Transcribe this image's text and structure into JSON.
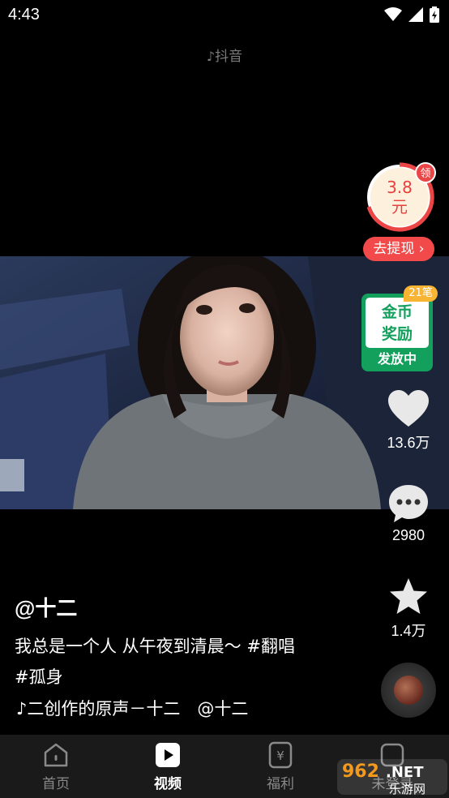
{
  "status_bar": {
    "time": "4:43"
  },
  "watermark": "抖音",
  "reward": {
    "amount": "3.8",
    "unit": "元",
    "tag": "领",
    "withdraw_label": "去提现 ›"
  },
  "coin_card": {
    "line1": "金币",
    "line2": "奖励",
    "status": "发放中",
    "badge": "21笔"
  },
  "actions": {
    "like_count": "13.6万",
    "comment_count": "2980",
    "favorite_count": "1.4万"
  },
  "author": "@十二",
  "caption_lines": [
    "我总是一个人 从午夜到清晨～ #翻唱",
    "#孤身"
  ],
  "music": "♪二创作的原声－十二　@十二",
  "nav": {
    "items": [
      {
        "label": "首页",
        "icon": "home-icon"
      },
      {
        "label": "视频",
        "icon": "video-icon"
      },
      {
        "label": "福利",
        "icon": "welfare-icon"
      },
      {
        "label": "未登录",
        "icon": "profile-icon"
      }
    ]
  },
  "site_logo": {
    "line1": "962.NET",
    "line2": "乐游网"
  },
  "colors": {
    "accent_red": "#f24a4a",
    "accent_green": "#12a05c",
    "nav_bg": "#1a1a1a"
  }
}
